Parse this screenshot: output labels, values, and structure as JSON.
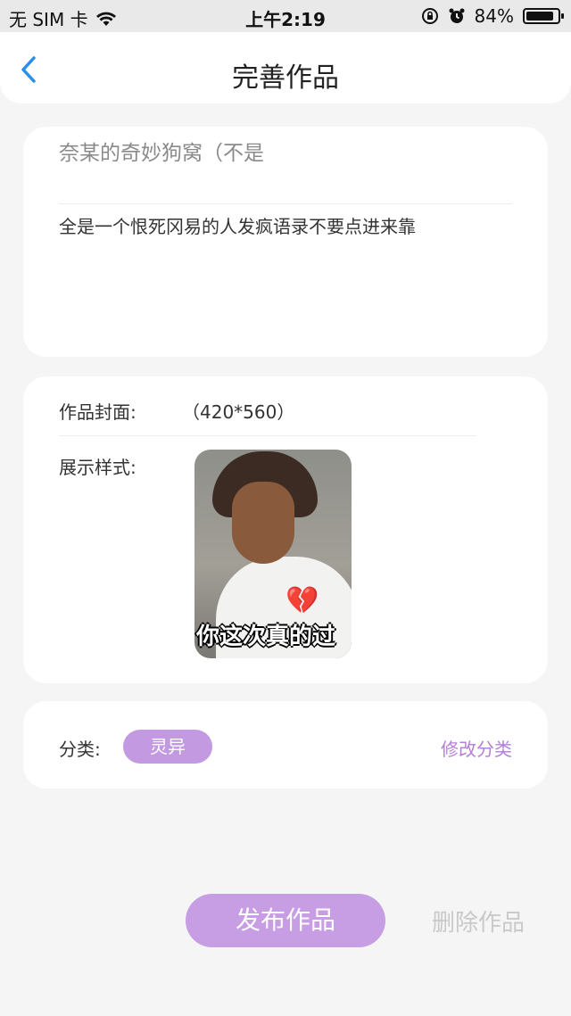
{
  "status_bar": {
    "carrier": "无 SIM 卡",
    "time": "上午2:19",
    "battery": "84%",
    "battery_level": 0.84
  },
  "nav": {
    "title": "完善作品"
  },
  "work": {
    "title": "奈某的奇妙狗窝（不是",
    "description": "全是一个恨死冈易的人发疯语录不要点进来靠"
  },
  "cover": {
    "label": "作品封面:",
    "size": "（420*560）",
    "style_label": "展示样式:",
    "image_caption": "你这次真的过"
  },
  "category": {
    "label": "分类:",
    "tag": "灵异",
    "edit_label": "修改分类"
  },
  "actions": {
    "publish": "发布作品",
    "delete": "删除作品"
  },
  "colors": {
    "accent": "#c79de4",
    "accent_text": "#b57fd6",
    "background": "#f5f5f5"
  }
}
